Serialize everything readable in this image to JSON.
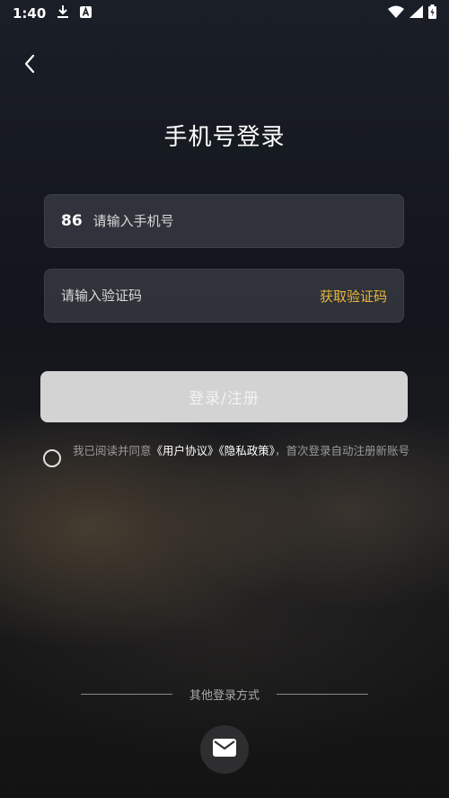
{
  "status_bar": {
    "time": "1:40"
  },
  "header": {
    "title": "手机号登录"
  },
  "phone": {
    "country_code": "86",
    "placeholder": "请输入手机号"
  },
  "code": {
    "placeholder": "请输入验证码",
    "get_code_label": "获取验证码"
  },
  "login_button": {
    "label": "登录/注册"
  },
  "agreement": {
    "prefix": "我已阅读并同意",
    "user_agreement": "《用户协议》",
    "privacy_policy": "《隐私政策》",
    "suffix": "，首次登录自动注册新账号"
  },
  "other_login": {
    "label": "其他登录方式"
  },
  "colors": {
    "accent": "#e8b73a",
    "button_bg": "#d3d3d3",
    "field_bg": "#3c3e46"
  },
  "icons": [
    "download-icon",
    "a-icon",
    "wifi-icon",
    "signal-icon",
    "battery-icon",
    "back-chevron-icon",
    "mail-icon"
  ]
}
